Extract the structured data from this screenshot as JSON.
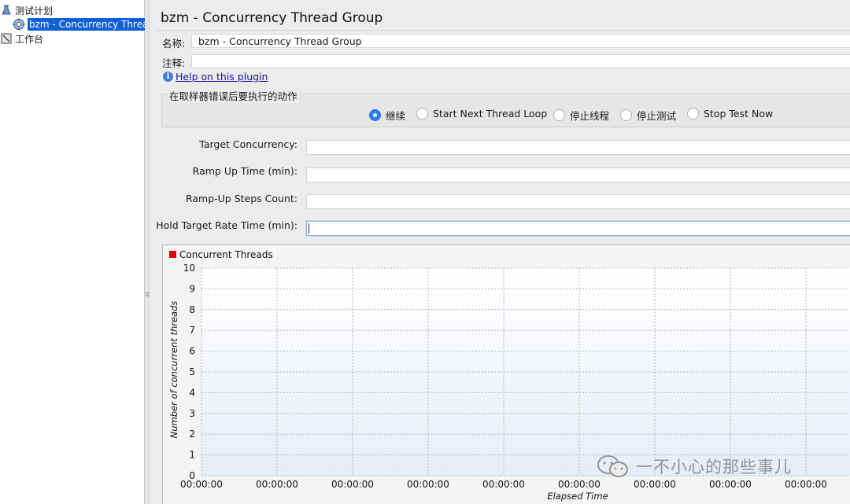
{
  "tree": {
    "items": [
      {
        "label": "测试计划",
        "icon": "test-plan-icon"
      },
      {
        "label": "bzm - Concurrency Threa",
        "icon": "gear-icon"
      },
      {
        "label": "工作台",
        "icon": "workbench-icon"
      }
    ]
  },
  "main": {
    "title": "bzm - Concurrency Thread Group",
    "name_label": "名称:",
    "name_value": "bzm - Concurrency Thread Group",
    "comment_label": "注释:",
    "comment_value": "",
    "help_link": "Help on this plugin",
    "on_error": {
      "title": "在取样器错误后要执行的动作",
      "options": [
        "继续",
        "Start Next Thread Loop",
        "停止线程",
        "停止测试",
        "Stop Test Now"
      ],
      "selected": "继续"
    },
    "params": [
      {
        "label": "Target Concurrency:",
        "value": ""
      },
      {
        "label": "Ramp Up Time (min):",
        "value": ""
      },
      {
        "label": "Ramp-Up Steps Count:",
        "value": ""
      },
      {
        "label": "Hold Target Rate Time (min):",
        "value": ""
      }
    ]
  },
  "chart_data": {
    "type": "line",
    "title": "",
    "legend": [
      {
        "name": "Concurrent Threads",
        "color": "#e00000"
      }
    ],
    "ylabel": "Number of concurrent threads",
    "xlabel": "Elapsed Time",
    "ylim": [
      0,
      10
    ],
    "yticks": [
      "0",
      "1",
      "2",
      "3",
      "4",
      "5",
      "6",
      "7",
      "8",
      "9",
      "10"
    ],
    "xticks": [
      "00:00:00",
      "00:00:00",
      "00:00:00",
      "00:00:00",
      "00:00:00",
      "00:00:00",
      "00:00:00",
      "00:00:00",
      "00:00:00"
    ],
    "series": [
      {
        "name": "Concurrent Threads",
        "values": []
      }
    ],
    "grid": true,
    "legend_position": "top-left",
    "colors": {
      "plot_top": "#ffffff",
      "plot_bottom": "#e6ecf6",
      "grid": "#b8b8b8"
    }
  },
  "watermark": {
    "text": "一不小心的那些事儿",
    "icon": "wechat-icon"
  }
}
